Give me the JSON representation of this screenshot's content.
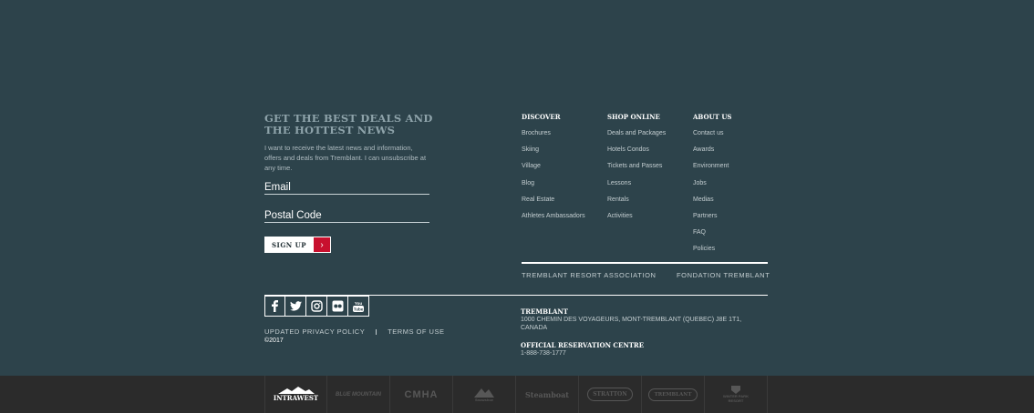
{
  "newsletter": {
    "title": "GET THE BEST DEALS AND THE HOTTEST NEWS",
    "text": "I want to receive the latest news and information, offers and deals from Tremblant. I can unsubscribe at any time.",
    "email_placeholder": "Email",
    "postal_placeholder": "Postal Code",
    "signup_label": "SIGN UP",
    "signup_icon": "chevron-right-icon"
  },
  "columns": {
    "discover": {
      "title": "DISCOVER",
      "items": [
        "Brochures",
        "Skiing",
        "Village",
        "Blog",
        "Real Estate",
        "Athletes Ambassadors"
      ]
    },
    "shop": {
      "title": "SHOP ONLINE",
      "items": [
        "Deals and Packages",
        "Hotels Condos",
        "Tickets and Passes",
        "Lessons",
        "Rentals",
        "Activities"
      ]
    },
    "about": {
      "title": "ABOUT US",
      "items": [
        "Contact us",
        "Awards",
        "Environment",
        "Jobs",
        "Medias",
        "Partners",
        "FAQ",
        "Policies"
      ]
    }
  },
  "associations": {
    "resort": "TREMBLANT RESORT ASSOCIATION",
    "foundation": "FONDATION TREMBLANT"
  },
  "social": [
    "facebook-icon",
    "twitter-icon",
    "instagram-icon",
    "flickr-icon",
    "youtube-icon"
  ],
  "legal": {
    "privacy": "UPDATED PRIVACY POLICY",
    "terms": "TERMS OF USE",
    "copyright": "©2017"
  },
  "contact": {
    "name": "TREMBLANT",
    "address": "1000 CHEMIN DES VOYAGEURS, MONT-TREMBLANT (QUEBEC) J8E 1T1, CANADA",
    "reservation_title": "OFFICIAL RESERVATION CENTRE",
    "phone": "1-888-738-1777"
  },
  "brands": [
    "INTRAWEST",
    "BLUE MOUNTAIN",
    "CMHA",
    "Snowshoe",
    "Steamboat",
    "STRATTON",
    "TREMBLANT",
    "WINTER PARK RESORT"
  ],
  "colors": {
    "background": "#2d434b",
    "brandbar": "#2b2b2b",
    "accent": "#c8102e"
  }
}
